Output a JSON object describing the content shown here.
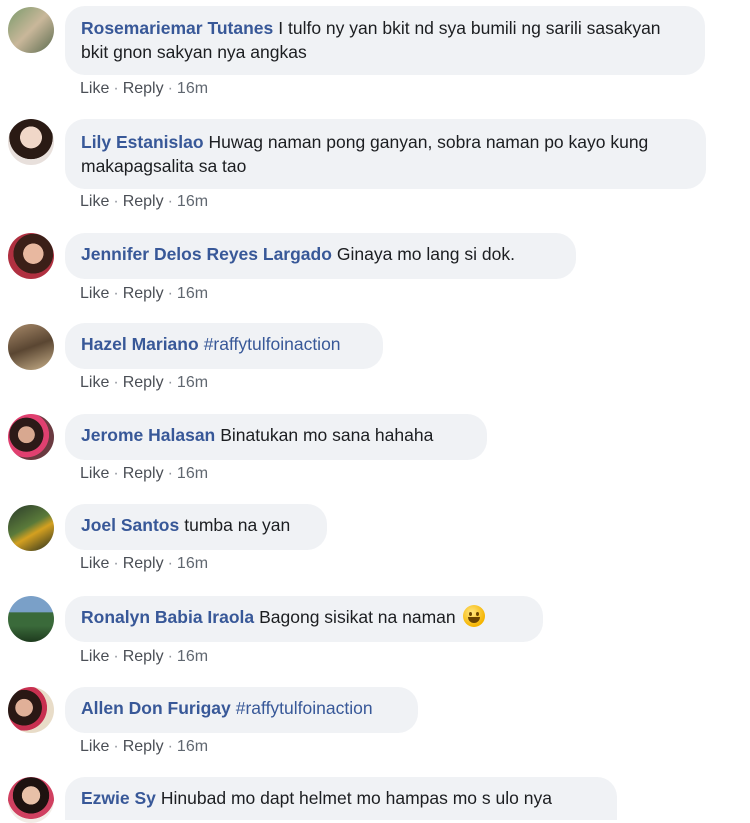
{
  "actions": {
    "like": "Like",
    "reply": "Reply",
    "separator": "·"
  },
  "comments": [
    {
      "author": "Rosemariemar Tutanes",
      "text": "I tulfo ny yan bkit nd sya bumili ng sarili sasakyan bkit gnon sakyan nya angkas",
      "time": "16m"
    },
    {
      "author": "Lily Estanislao",
      "text": "Huwag naman pong ganyan, sobra naman po kayo kung makapagsalita sa tao",
      "time": "16m"
    },
    {
      "author": "Jennifer Delos Reyes Largado",
      "text": "Ginaya mo lang si dok.",
      "time": "16m"
    },
    {
      "author": "Hazel Mariano",
      "text": "#raffytulfoinaction",
      "time": "16m"
    },
    {
      "author": "Jerome Halasan",
      "text": "Binatukan mo sana hahaha",
      "time": "16m"
    },
    {
      "author": "Joel Santos",
      "text": "tumba na yan",
      "time": "16m"
    },
    {
      "author": "Ronalyn Babia Iraola",
      "text": "Bagong sisikat na naman",
      "emoji": "grinning-face-emoji",
      "time": "16m"
    },
    {
      "author": "Allen Don Furigay",
      "text": "#raffytulfoinaction",
      "time": "16m"
    },
    {
      "author": "Ezwie Sy",
      "text": "Hinubad mo dapt helmet mo hampas mo s ulo nya"
    }
  ]
}
